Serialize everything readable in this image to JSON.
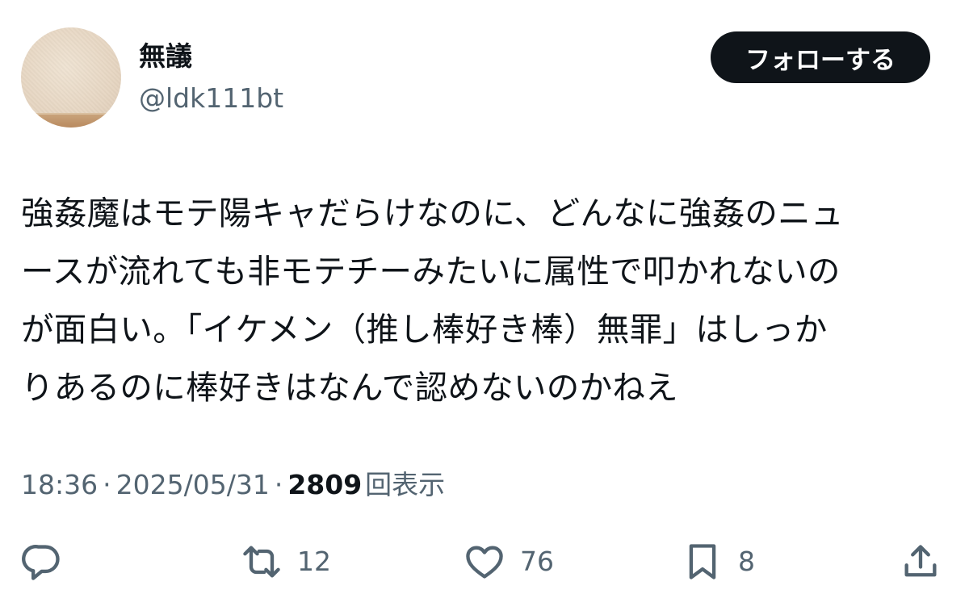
{
  "author": {
    "display_name": "無議",
    "handle": "@ldk111bt"
  },
  "follow_button": {
    "label": "フォローする"
  },
  "tweet": {
    "lines": [
      "強姦魔はモテ陽キャだらけなのに、どんなに強姦のニュ",
      "ースが流れても非モテチーみたいに属性で叩かれないの",
      "が面白い。「イケメン（推し棒好き棒）無罪」はしっか",
      "りあるのに棒好きはなんで認めないのかねえ"
    ]
  },
  "meta": {
    "time": "18:36",
    "separator": "·",
    "date": "2025/05/31",
    "views_count": "2809",
    "views_label": "回表示"
  },
  "actions": {
    "reply": {
      "icon": "reply-icon",
      "count": ""
    },
    "retweet": {
      "icon": "retweet-icon",
      "count": "12"
    },
    "like": {
      "icon": "heart-icon",
      "count": "76"
    },
    "bookmark": {
      "icon": "bookmark-icon",
      "count": "8"
    },
    "share": {
      "icon": "share-icon"
    }
  },
  "colors": {
    "text_primary": "#0f1419",
    "text_secondary": "#536471",
    "button_background": "#0f1419",
    "button_text": "#ffffff",
    "background": "#ffffff"
  }
}
